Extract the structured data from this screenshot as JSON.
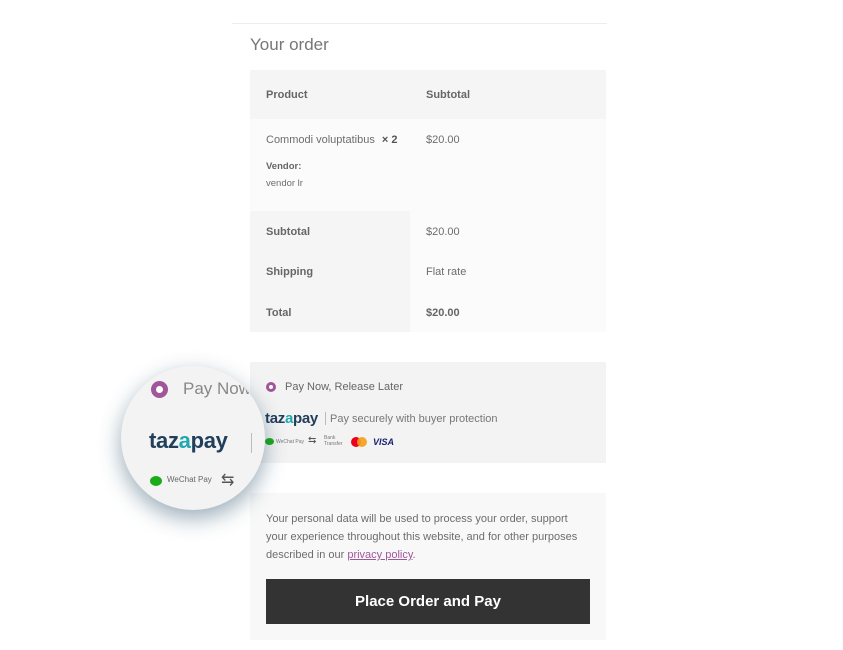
{
  "order": {
    "title": "Your order",
    "headers": {
      "product": "Product",
      "subtotal": "Subtotal"
    },
    "item": {
      "name": "Commodi voluptatibus",
      "qty": "× 2",
      "price": "$20.00",
      "vendor_label": "Vendor:",
      "vendor_name": "vendor lr"
    },
    "totals": {
      "subtotal_label": "Subtotal",
      "subtotal_value": "$20.00",
      "shipping_label": "Shipping",
      "shipping_value": "Flat rate",
      "total_label": "Total",
      "total_value": "$20.00"
    }
  },
  "payment": {
    "method_label": "Pay Now, Release Later",
    "logo_text_prefix": "taz",
    "logo_text_accent": "a",
    "logo_text_suffix": "pay",
    "description": "Pay securely with buyer protection",
    "icons": {
      "wechat": "WeChat Pay",
      "bank_top": "Bank",
      "bank_bottom": "Transfer",
      "visa": "VISA"
    },
    "magnifier_label": "Pay Now",
    "radio_color": "#a0579a"
  },
  "privacy": {
    "text": "Your personal data will be used to process your order, support your experience throughout this website, and for other purposes described in our ",
    "link": "privacy policy",
    "end": "."
  },
  "button": {
    "label": "Place Order and Pay"
  }
}
